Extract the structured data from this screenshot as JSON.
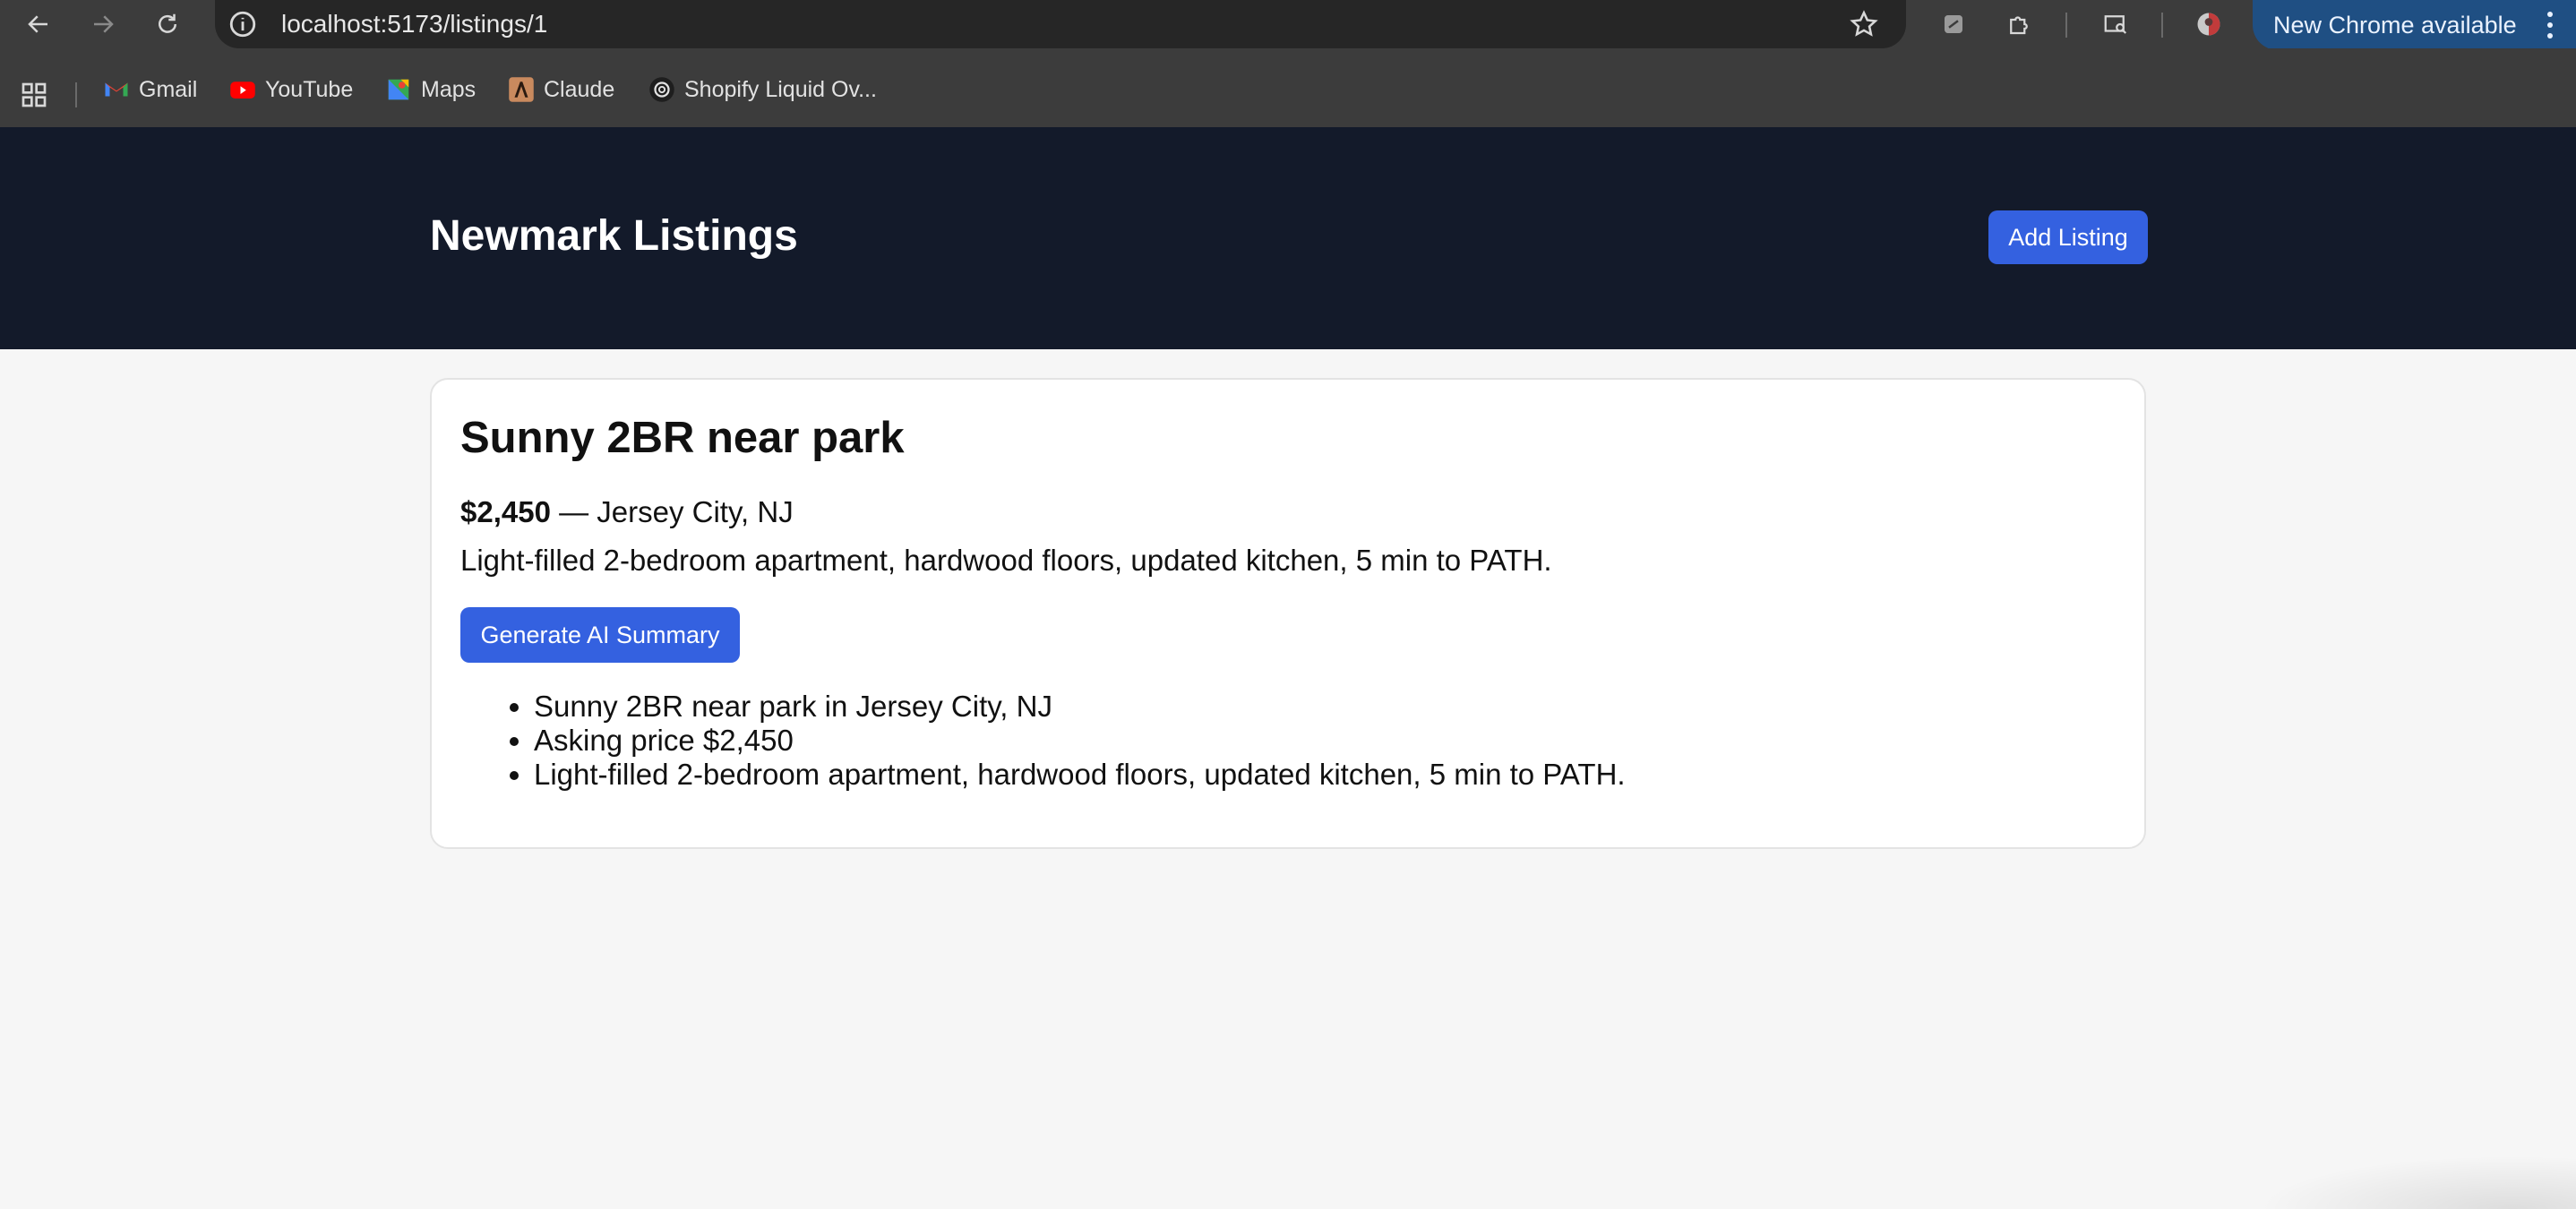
{
  "browser": {
    "url": "localhost:5173/listings/1",
    "update_label": "New Chrome available",
    "icons": {
      "back": "arrow-left-icon",
      "forward": "arrow-right-icon",
      "reload": "reload-icon",
      "site_info": "info-icon",
      "bookmark_star": "star-icon",
      "extension_1": "extension-icon",
      "extensions": "puzzle-icon",
      "tab_search": "tab-search-icon",
      "profile": "avatar-icon",
      "menu": "kebab-menu-icon"
    }
  },
  "bookmarks": {
    "apps_icon": "grid-icon",
    "items": [
      {
        "label": "Gmail",
        "icon": "gmail-icon"
      },
      {
        "label": "YouTube",
        "icon": "youtube-icon"
      },
      {
        "label": "Maps",
        "icon": "maps-icon"
      },
      {
        "label": "Claude",
        "icon": "claude-icon"
      },
      {
        "label": "Shopify Liquid Ov...",
        "icon": "openai-icon"
      }
    ]
  },
  "header": {
    "title": "Newmark Listings",
    "add_button": "Add Listing"
  },
  "listing": {
    "title": "Sunny 2BR near park",
    "price": "$2,450",
    "location_sep": " — Jersey City, NJ",
    "description": "Light-filled 2-bedroom apartment, hardwood floors, updated kitchen, 5 min to PATH.",
    "generate_button": "Generate AI Summary",
    "summary": [
      "Sunny 2BR near park in Jersey City, NJ",
      "Asking price $2,450",
      "Light-filled 2-bedroom apartment, hardwood floors, updated kitchen, 5 min to PATH."
    ]
  },
  "colors": {
    "header_bg": "#131a2a",
    "accent": "#3461e0",
    "page_bg": "#f6f6f6",
    "chrome_bg": "#3c3c3c",
    "update_pill": "#1f4f83"
  }
}
